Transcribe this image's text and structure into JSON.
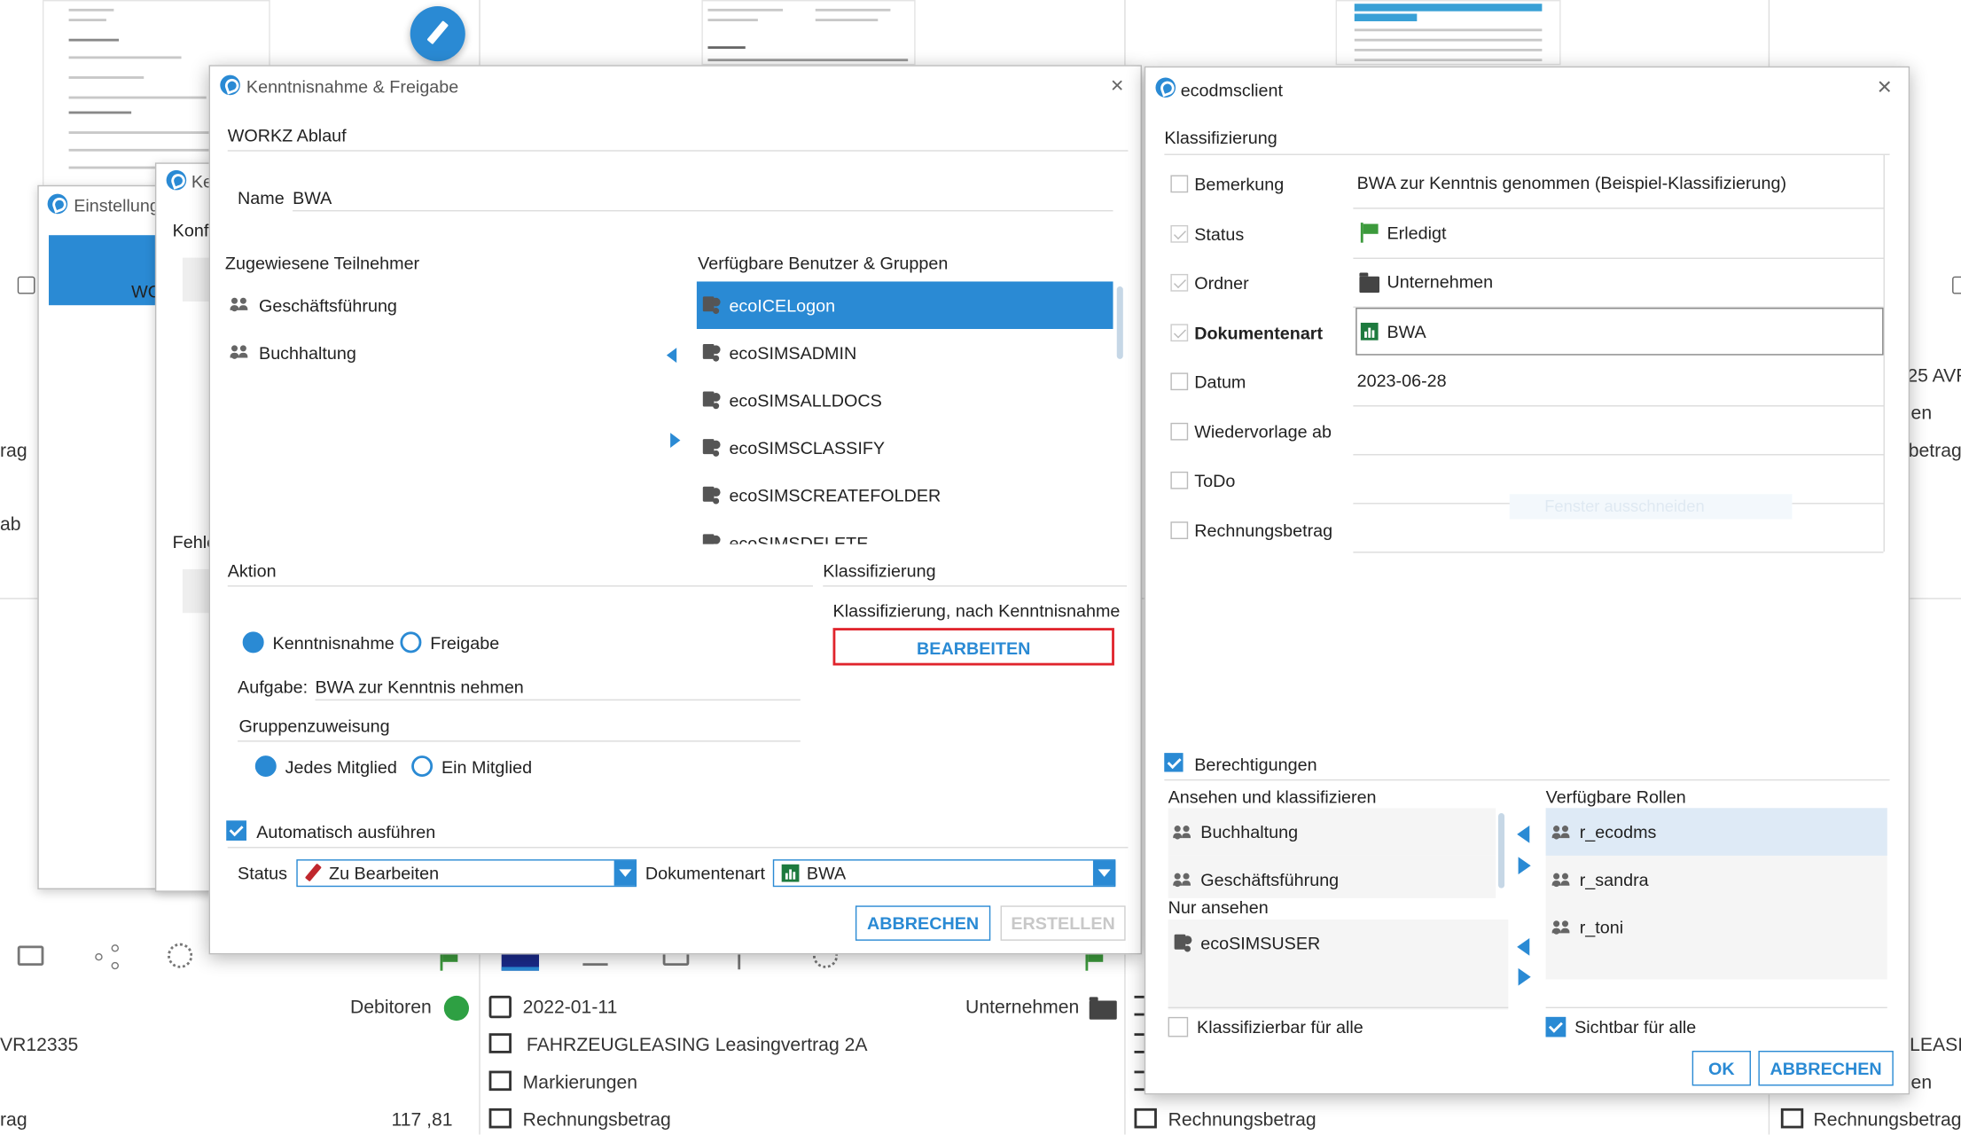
{
  "background": {
    "left_strip": {
      "text1": "rag",
      "text2": "ab",
      "ref": "VR12335",
      "row_label": "rag",
      "amount": "117 ,81",
      "debitoren": "Debitoren"
    },
    "center_card": {
      "date": "2022-01-11",
      "title": "FAHRZEUGLEASING Leasingvertrag 2A",
      "field1": "Markierungen",
      "field2": "Rechnungsbetrag",
      "folder_label": "Unternehmen"
    },
    "right_card": {
      "field": "Rechnungsbetrag"
    },
    "far_right": {
      "t1": "25 AVR",
      "t2": "en",
      "t3": "betrag",
      "t4": "LEASI",
      "t5": "en",
      "t6": "Rechnungsbetrag"
    },
    "underlying_windows": {
      "w1_title": "Einstellunge",
      "w1_tab": "WO",
      "w2_title": "Ke",
      "w2_text1": "Konf",
      "w2_text2": "Fehle"
    },
    "ghost_text": "Fenster ausschneiden"
  },
  "dialog_left": {
    "title": "Kenntnisnahme & Freigabe",
    "workflow_header": "WORKZ Ablauf",
    "name_label": "Name",
    "name_value": "BWA",
    "assigned_header": "Zugewiesene Teilnehmer",
    "assigned": [
      {
        "label": "Geschäftsführung"
      },
      {
        "label": "Buchhaltung"
      }
    ],
    "available_header": "Verfügbare Benutzer & Gruppen",
    "available": [
      {
        "label": "ecoICELogon",
        "selected": true
      },
      {
        "label": "ecoSIMSADMIN"
      },
      {
        "label": "ecoSIMSALLDOCS"
      },
      {
        "label": "ecoSIMSCLASSIFY"
      },
      {
        "label": "ecoSIMSCREATEFOLDER"
      },
      {
        "label": "ecoSIMSDELETE"
      }
    ],
    "action_header": "Aktion",
    "action_options": {
      "kenntnisnahme": "Kenntnisnahme",
      "freigabe": "Freigabe",
      "selected": "Kenntnisnahme"
    },
    "task_label": "Aufgabe:",
    "task_value": "BWA zur Kenntnis nehmen",
    "group_header": "Gruppenzuweisung",
    "group_options": {
      "jedes": "Jedes Mitglied",
      "ein": "Ein Mitglied",
      "selected": "Jedes Mitglied"
    },
    "classification_header": "Klassifizierung",
    "classification_text": "Klassifizierung, nach Kenntnisnahme",
    "edit_button": "BEARBEITEN",
    "auto_execute_label": "Automatisch ausführen",
    "auto_execute_checked": true,
    "status_label": "Status",
    "status_value": "Zu Bearbeiten",
    "doctype_label": "Dokumentenart",
    "doctype_value": "BWA",
    "cancel_button": "ABBRECHEN",
    "create_button": "ERSTELLEN",
    "accent_color": "#2a8ad4",
    "highlight_border_color": "#e0242c"
  },
  "dialog_right": {
    "title": "ecodmsclient",
    "classification_header": "Klassifizierung",
    "fields": [
      {
        "label": "Bemerkung",
        "value": "BWA zur Kenntnis genommen (Beispiel-Klassifizierung)",
        "checked": false,
        "bold": false,
        "icon": ""
      },
      {
        "label": "Status",
        "value": "Erledigt",
        "checked": true,
        "bold": false,
        "icon": "flag-icon"
      },
      {
        "label": "Ordner",
        "value": "Unternehmen",
        "checked": true,
        "bold": false,
        "icon": "folder-icon"
      },
      {
        "label": "Dokumentenart",
        "value": "BWA",
        "checked": true,
        "bold": true,
        "icon": "chart-icon"
      },
      {
        "label": "Datum",
        "value": "2023-06-28",
        "checked": false,
        "bold": false,
        "icon": ""
      },
      {
        "label": "Wiedervorlage ab",
        "value": "",
        "checked": false,
        "bold": false,
        "icon": ""
      },
      {
        "label": "ToDo",
        "value": "",
        "checked": false,
        "bold": false,
        "icon": ""
      },
      {
        "label": "Rechnungsbetrag",
        "value": "",
        "checked": false,
        "bold": false,
        "icon": ""
      }
    ],
    "permissions_label": "Berechtigungen",
    "permissions_checked": true,
    "view_classify_header": "Ansehen und klassifizieren",
    "view_classify": [
      {
        "label": "Buchhaltung"
      },
      {
        "label": "Geschäftsführung"
      }
    ],
    "view_only_header": "Nur ansehen",
    "view_only": [
      {
        "label": "ecoSIMSUSER"
      }
    ],
    "roles_header": "Verfügbare Rollen",
    "roles": [
      {
        "label": "r_ecodms",
        "selected": true
      },
      {
        "label": "r_sandra"
      },
      {
        "label": "r_toni"
      }
    ],
    "classifiable_all": "Klassifizierbar für alle",
    "classifiable_all_checked": false,
    "visible_all": "Sichtbar für alle",
    "visible_all_checked": true,
    "ok_button": "OK",
    "cancel_button": "ABBRECHEN"
  }
}
